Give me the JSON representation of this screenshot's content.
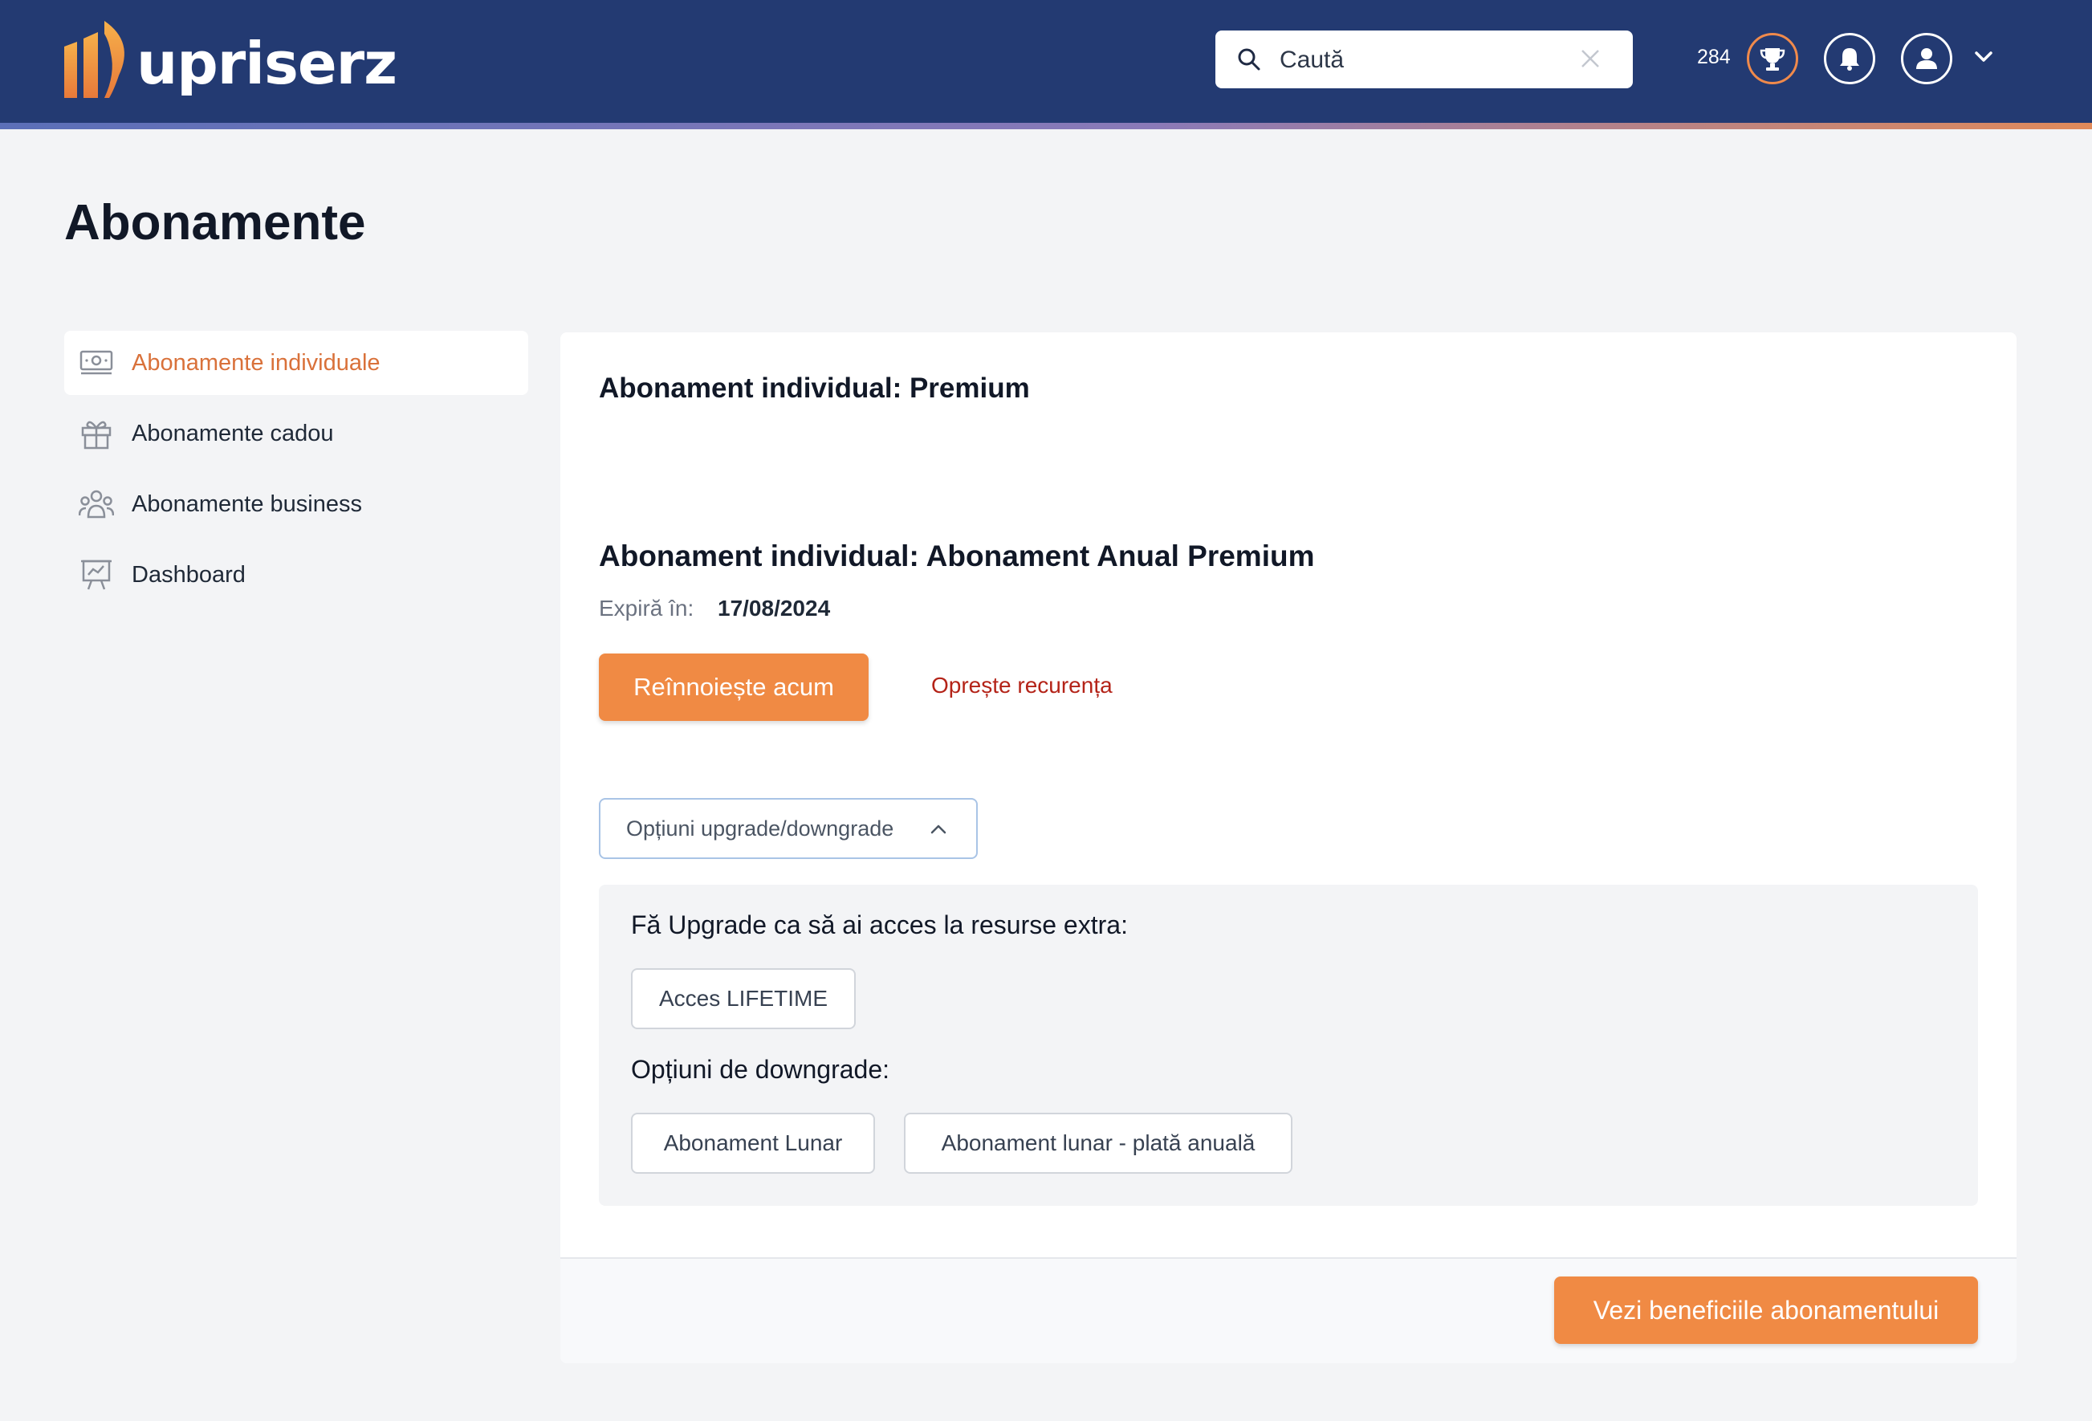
{
  "header": {
    "brand": "upriserz",
    "search": {
      "value": "Caută"
    },
    "points": "284",
    "icons": [
      "search-icon",
      "clear-icon",
      "trophy-icon",
      "bell-icon",
      "user-icon",
      "chevron-down-icon"
    ],
    "colors": {
      "bar": "#233a72",
      "accent": "#f08a44"
    }
  },
  "page": {
    "title": "Abonamente"
  },
  "sidebar": {
    "items": [
      {
        "label": "Abonamente individuale",
        "icon": "money-icon",
        "active": true
      },
      {
        "label": "Abonamente cadou",
        "icon": "gift-icon",
        "active": false
      },
      {
        "label": "Abonamente business",
        "icon": "users-icon",
        "active": false
      },
      {
        "label": "Dashboard",
        "icon": "presentation-chart-icon",
        "active": false
      }
    ]
  },
  "main": {
    "premium_title": "Abonament individual: Premium",
    "annual_title": "Abonament individual: Abonament Anual Premium",
    "expires_label": "Expiră în:",
    "expires_date": "17/08/2024",
    "renew_button": "Reînnoiește acum",
    "stop_link": "Oprește recurența",
    "options_button": "Opțiuni upgrade/downgrade",
    "upgrade_title": "Fă Upgrade ca să ai acces la resurse extra:",
    "upgrade_options": [
      "Acces LIFETIME"
    ],
    "downgrade_title": "Opțiuni de downgrade:",
    "downgrade_options": [
      "Abonament Lunar",
      "Abonament lunar - plată anuală"
    ],
    "benefits_button": "Vezi beneficiile abonamentului"
  }
}
